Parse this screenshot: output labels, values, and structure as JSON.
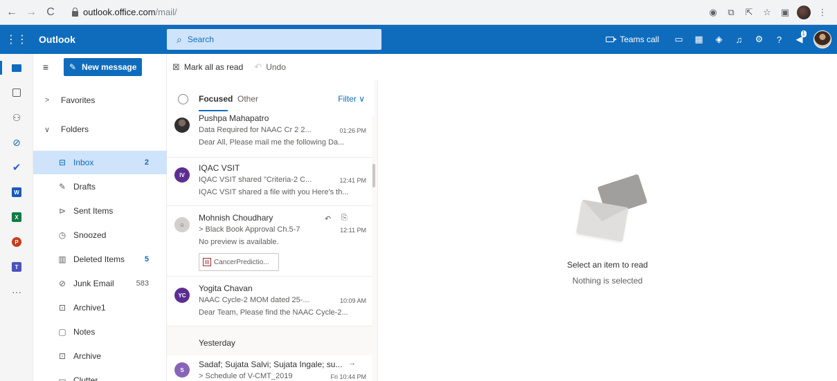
{
  "browser": {
    "url_host": "outlook.office.com",
    "url_path": "/mail/"
  },
  "header": {
    "app_name": "Outlook",
    "search_placeholder": "Search",
    "teams_call_label": "Teams call",
    "notification_count": "1"
  },
  "toolbar": {
    "new_message_label": "New message",
    "mark_all_read_label": "Mark all as read",
    "undo_label": "Undo"
  },
  "folders": {
    "favorites_label": "Favorites",
    "folders_label": "Folders",
    "items": [
      {
        "label": "Inbox",
        "count": "2",
        "icon": "inbox-icon"
      },
      {
        "label": "Drafts",
        "count": "",
        "icon": "drafts-icon"
      },
      {
        "label": "Sent Items",
        "count": "",
        "icon": "sent-icon"
      },
      {
        "label": "Snoozed",
        "count": "",
        "icon": "clock-icon"
      },
      {
        "label": "Deleted Items",
        "count": "5",
        "icon": "trash-icon"
      },
      {
        "label": "Junk Email",
        "count": "583",
        "icon": "junk-icon"
      },
      {
        "label": "Archive1",
        "count": "",
        "icon": "archive-icon"
      },
      {
        "label": "Notes",
        "count": "",
        "icon": "notes-icon"
      },
      {
        "label": "Archive",
        "count": "",
        "icon": "archive-icon"
      },
      {
        "label": "Clutter",
        "count": "",
        "icon": "folder-icon"
      }
    ]
  },
  "message_list": {
    "tab_focused": "Focused",
    "tab_other": "Other",
    "filter_label": "Filter",
    "group_yesterday": "Yesterday",
    "messages": [
      {
        "sender": "Pushpa Mahapatro",
        "subject": "Data Required for NAAC Cr 2 2...",
        "time": "01:26 PM",
        "preview": "Dear All, Please mail me the following Da...",
        "initials": "",
        "avatar_color": "#5c5c5c"
      },
      {
        "sender": "IQAC VSIT",
        "subject": "IQAC VSIT shared \"Criteria-2 C...",
        "time": "12:41 PM",
        "preview": "IQAC VSIT shared a file with you Here's th...",
        "initials": "IV",
        "avatar_color": "#5c2e91"
      },
      {
        "sender": "Mohnish Choudhary",
        "subject": "> Black Book Approval Ch.5-7",
        "time": "12:11 PM",
        "preview": "No preview is available.",
        "initials": "",
        "avatar_color": "#8a8886",
        "attachment": "CancerPredictio..."
      },
      {
        "sender": "Yogita Chavan",
        "subject": "NAAC Cycle-2 MOM dated 25-...",
        "time": "10:09 AM",
        "preview": "Dear Team, Please find the NAAC Cycle-2...",
        "initials": "YC",
        "avatar_color": "#5c2e91"
      },
      {
        "sender": "Sadaf; Sujata Salvi; Sujata Ingale; su...",
        "subject": "> Schedule of V-CMT_2019",
        "time": "Fri 10:44 PM",
        "preview": "",
        "initials": "S",
        "avatar_color": "#8764b8"
      }
    ]
  },
  "reading_pane": {
    "title": "Select an item to read",
    "subtitle": "Nothing is selected"
  },
  "colors": {
    "brand": "#0f6cbd",
    "selected_folder": "#cfe4fa",
    "search_bg": "#cfe4fa"
  }
}
